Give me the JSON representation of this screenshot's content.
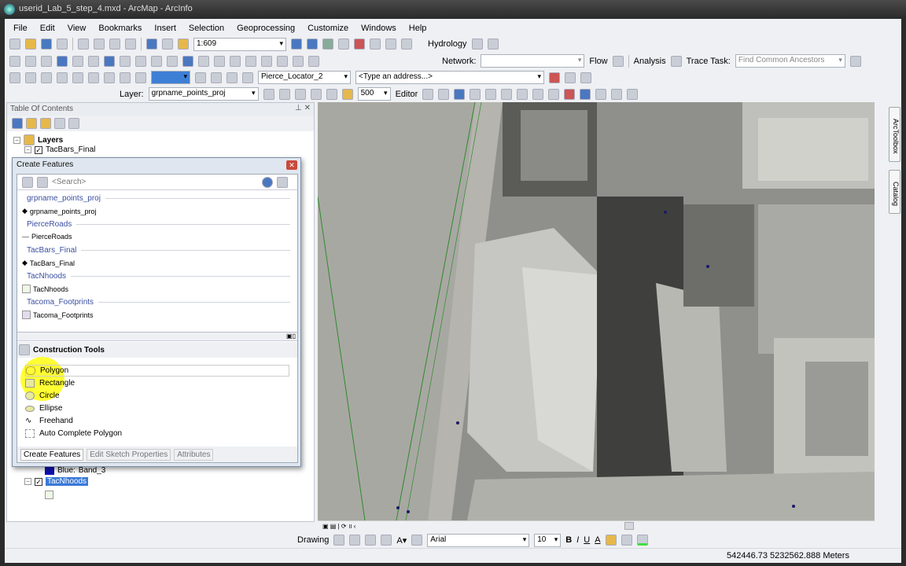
{
  "window": {
    "title": "userid_Lab_5_step_4.mxd - ArcMap - ArcInfo"
  },
  "menu": [
    "File",
    "Edit",
    "View",
    "Bookmarks",
    "Insert",
    "Selection",
    "Geoprocessing",
    "Customize",
    "Windows",
    "Help"
  ],
  "toolbars": {
    "scale": "1:609",
    "hydrology": "Hydrology",
    "network_label": "Network:",
    "network_value": "",
    "flow": "Flow",
    "analysis": "Analysis",
    "trace_task_label": "Trace Task:",
    "trace_task_value": "Find Common Ancestors",
    "locator": "Pierce_Locator_2",
    "address_placeholder": "<Type an address...>",
    "layer_label": "Layer:",
    "layer_value": "grpname_points_proj",
    "snap_value": "500",
    "editor": "Editor"
  },
  "toc": {
    "title": "Table Of Contents",
    "root": "Layers",
    "layer1": "TacBars_Final",
    "band_label": "Blue:",
    "band_value": "Band_3",
    "layer_selected": "TacNhoods"
  },
  "create_features": {
    "title": "Create Features",
    "search_placeholder": "<Search>",
    "templates": [
      {
        "group": "grpname_points_proj",
        "item": "grpname_points_proj",
        "kind": "point"
      },
      {
        "group": "PierceRoads",
        "item": "PierceRoads",
        "kind": "line"
      },
      {
        "group": "TacBars_Final",
        "item": "TacBars_Final",
        "kind": "point"
      },
      {
        "group": "TacNhoods",
        "item": "TacNhoods",
        "kind": "poly-green"
      },
      {
        "group": "Tacoma_Footprints",
        "item": "Tacoma_Footprints",
        "kind": "poly-purple"
      }
    ],
    "construction_header": "Construction Tools",
    "tools": [
      "Polygon",
      "Rectangle",
      "Circle",
      "Ellipse",
      "Freehand",
      "Auto Complete Polygon"
    ],
    "selected_tool": "Polygon",
    "tabs": [
      "Create Features",
      "Edit Sketch Properties",
      "Attributes"
    ]
  },
  "dock": {
    "arctoolbox": "ArcToolbox",
    "catalog": "Catalog"
  },
  "drawing": {
    "label": "Drawing",
    "font": "Arial",
    "size": "10",
    "bold": "B",
    "italic": "I",
    "underline": "U",
    "font_color": "A"
  },
  "status": {
    "coords": "542446.73  5232562.888 Meters"
  }
}
